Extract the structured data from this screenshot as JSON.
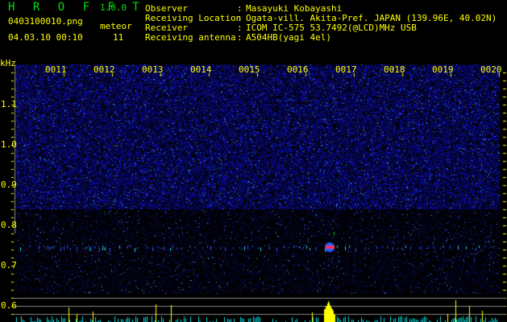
{
  "app": {
    "title": "H R O F F T",
    "version": "1.0.0"
  },
  "file": {
    "name": "0403100010.png",
    "datetime": "04.03.10 00:10"
  },
  "meteor": {
    "label": "meteor",
    "count": "11"
  },
  "info": [
    {
      "label": "Observer",
      "value": "Masayuki Kobayashi"
    },
    {
      "label": "Receiving Location",
      "value": "Ogata-vill. Akita-Pref. JAPAN (139.96E, 40.02N)"
    },
    {
      "label": "Receiver",
      "value": "ICOM IC-575 53.7492(@LCD)MHz USB"
    },
    {
      "label": "Receiving antenna",
      "value": "A504HB(yagi 4el)"
    }
  ],
  "axis": {
    "unit": "kHz",
    "y_labels": [
      "1.1",
      "1.0",
      "0.9",
      "0.8",
      "0.7",
      "0.6"
    ],
    "time_labels": [
      "0011",
      "0012",
      "0013",
      "0014",
      "0015",
      "0016",
      "0017",
      "0018",
      "0019",
      "0020"
    ]
  },
  "colors": {
    "text": "#ffff00",
    "title": "#00e000",
    "noise": "#2020c0",
    "histogram": "#00e0e0",
    "meteor_bar": "#ffff00"
  }
}
